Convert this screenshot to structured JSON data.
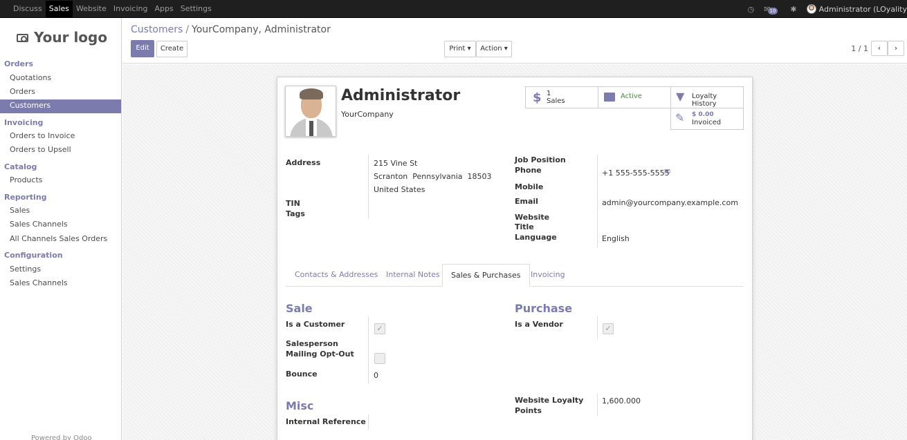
{
  "topbar": {
    "menu": [
      "Discuss",
      "Sales",
      "Website",
      "Invoicing",
      "Apps",
      "Settings"
    ],
    "active_menu": "Sales",
    "notification_count": "10",
    "user": "Administrator (LOyality"
  },
  "sidebar": {
    "logo_text": "Your logo",
    "sections": [
      {
        "title": "Orders",
        "items": [
          "Quotations",
          "Orders",
          "Customers"
        ]
      },
      {
        "title": "Invoicing",
        "items": [
          "Orders to Invoice",
          "Orders to Upsell"
        ]
      },
      {
        "title": "Catalog",
        "items": [
          "Products"
        ]
      },
      {
        "title": "Reporting",
        "items": [
          "Sales",
          "Sales Channels",
          "All Channels Sales Orders"
        ]
      },
      {
        "title": "Configuration",
        "items": [
          "Settings",
          "Sales Channels"
        ]
      }
    ],
    "active_item": "Customers",
    "footer": "Powered by Odoo"
  },
  "control": {
    "breadcrumb_parent": "Customers",
    "breadcrumb_sep": "/",
    "breadcrumb_current": "YourCompany, Administrator",
    "edit_label": "Edit",
    "create_label": "Create",
    "print_label": "Print ▾",
    "action_label": "Action ▾",
    "pager": "1 / 1"
  },
  "record": {
    "name": "Administrator",
    "company": "YourCompany",
    "stats": {
      "sales_count": "1",
      "sales_label": "Sales",
      "active_label": "Active",
      "loyalty_label": "Loyalty History",
      "invoiced_amount": "$ 0.00",
      "invoiced_label": "Invoiced"
    },
    "left_fields": {
      "address_label": "Address",
      "address_line1": "215 Vine St",
      "address_line2": "Scranton  Pennsylvania  18503",
      "address_line3": "United States",
      "tin_label": "TIN",
      "tags_label": "Tags"
    },
    "right_fields": {
      "job_label": "Job Position",
      "phone_label": "Phone",
      "phone_value": "+1 555-555-5555",
      "mobile_label": "Mobile",
      "email_label": "Email",
      "email_value": "admin@yourcompany.example.com",
      "website_label": "Website",
      "title_label": "Title",
      "language_label": "Language",
      "language_value": "English"
    },
    "tabs": [
      "Contacts & Addresses",
      "Internal Notes",
      "Sales & Purchases",
      "Invoicing"
    ],
    "active_tab": "Sales & Purchases",
    "sale": {
      "title": "Sale",
      "is_customer_label": "Is a Customer",
      "is_customer": true,
      "salesperson_label": "Salesperson",
      "mailing_label": "Mailing Opt-Out",
      "mailing_opt_out": false,
      "bounce_label": "Bounce",
      "bounce_value": "0"
    },
    "purchase": {
      "title": "Purchase",
      "is_vendor_label": "Is a Vendor",
      "is_vendor": true
    },
    "misc": {
      "title": "Misc",
      "internal_ref_label": "Internal Reference",
      "loyalty_label_1": "Website Loyalty",
      "loyalty_label_2": "Points",
      "loyalty_value": "1,600.000"
    }
  },
  "colors": {
    "accent": "#7c7bad",
    "topbar": "#1f1f1f"
  }
}
